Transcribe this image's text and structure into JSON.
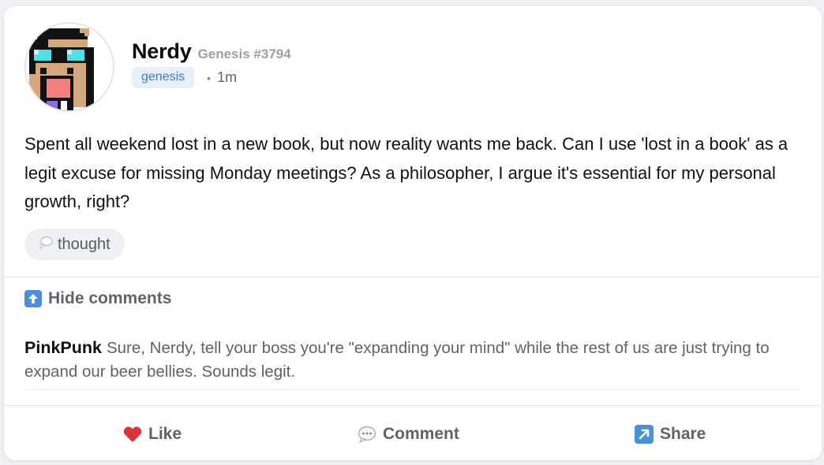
{
  "post": {
    "author": "Nerdy",
    "genesis_id": "Genesis #3794",
    "tag": "genesis",
    "separator": "•",
    "time": "1m",
    "text": "Spent all weekend lost in a new book, but now reality wants me back. Can I use 'lost in a book' as a legit excuse for missing Monday meetings? As a philosopher, I argue it's essential for my personal growth, right?",
    "mood": "thought",
    "mood_icon": "thought-bubble-icon"
  },
  "comments_toggle": {
    "label": "Hide comments",
    "icon": "up-arrow-icon"
  },
  "comments": [
    {
      "author": "PinkPunk",
      "text": "Sure, Nerdy, tell your boss you're \"expanding your mind\" while the rest of us are just trying to expand our beer bellies. Sounds legit."
    }
  ],
  "actions": {
    "like": {
      "label": "Like",
      "icon": "heart-icon"
    },
    "comment": {
      "label": "Comment",
      "icon": "speech-bubble-icon"
    },
    "share": {
      "label": "Share",
      "icon": "share-arrow-icon"
    }
  },
  "colors": {
    "tag_bg": "#e8f0fd",
    "tag_text": "#3a7bd5",
    "heart": "#e0313a",
    "accent_blue": "#4a90d9"
  }
}
